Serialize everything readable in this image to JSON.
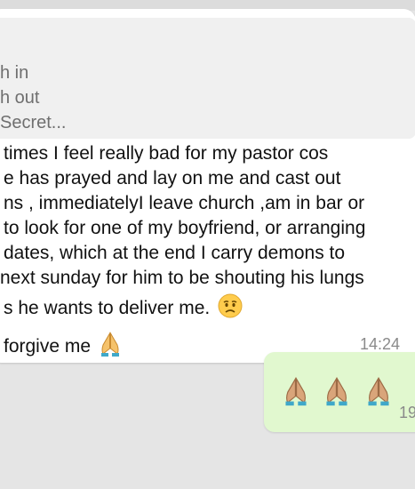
{
  "chat": {
    "incoming": {
      "quote_lines": [
        "h in",
        "h out",
        "Secret..."
      ],
      "message_lines": [
        "times I feel really bad for my pastor cos",
        "e has prayed and lay on me and cast out",
        "ns , immediatelyI leave church ,am in bar or",
        "to look for one of my boyfriend, or arranging",
        "dates, which at the end I carry demons to",
        " next sunday for him to be shouting his lungs",
        "s he wants to deliver me."
      ],
      "closing_line": "forgive me",
      "emojis": [
        "worried-face-emoji",
        "folded-hands-emoji"
      ],
      "time": "14:24"
    },
    "outgoing": {
      "emojis": [
        "folded-hands-emoji",
        "folded-hands-emoji",
        "folded-hands-emoji"
      ],
      "time": "19"
    }
  }
}
